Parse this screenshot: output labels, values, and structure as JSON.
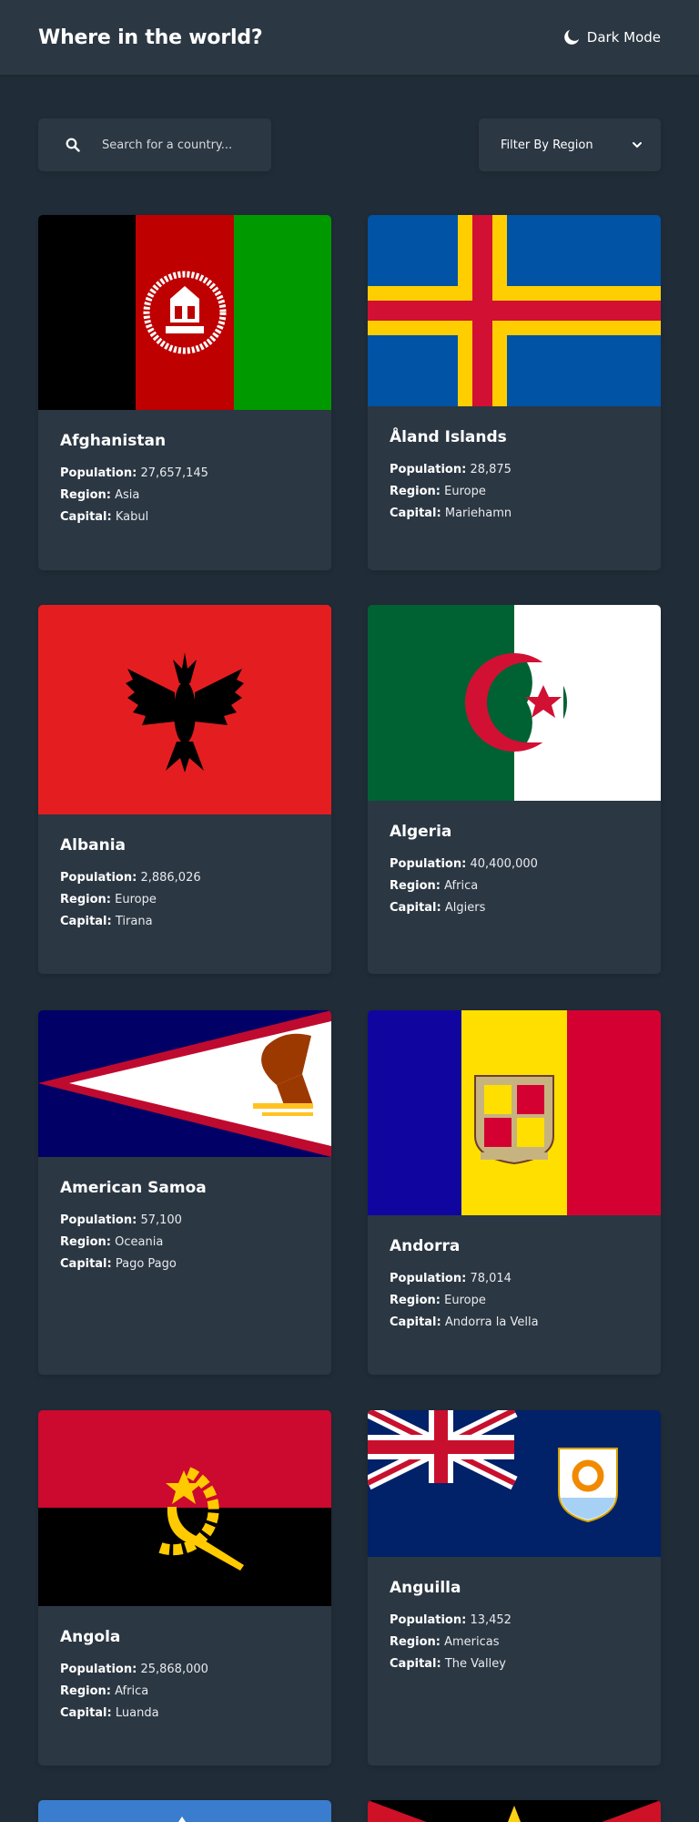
{
  "header": {
    "title": "Where in the world?",
    "mode_label": "Dark Mode"
  },
  "search": {
    "placeholder": "Search for a country..."
  },
  "filter": {
    "label": "Filter By Region"
  },
  "labels": {
    "population": "Population:",
    "region": "Region:",
    "capital": "Capital:"
  },
  "countries": [
    {
      "name": "Afghanistan",
      "population": "27,657,145",
      "region": "Asia",
      "capital": "Kabul"
    },
    {
      "name": "Åland Islands",
      "population": "28,875",
      "region": "Europe",
      "capital": "Mariehamn"
    },
    {
      "name": "Albania",
      "population": "2,886,026",
      "region": "Europe",
      "capital": "Tirana"
    },
    {
      "name": "Algeria",
      "population": "40,400,000",
      "region": "Africa",
      "capital": "Algiers"
    },
    {
      "name": "American Samoa",
      "population": "57,100",
      "region": "Oceania",
      "capital": "Pago Pago"
    },
    {
      "name": "Andorra",
      "population": "78,014",
      "region": "Europe",
      "capital": "Andorra la Vella"
    },
    {
      "name": "Angola",
      "population": "25,868,000",
      "region": "Africa",
      "capital": "Luanda"
    },
    {
      "name": "Anguilla",
      "population": "13,452",
      "region": "Americas",
      "capital": "The Valley"
    }
  ],
  "colors": {
    "background": "#202c37",
    "surface": "#2b3743",
    "text": "#ffffff"
  }
}
